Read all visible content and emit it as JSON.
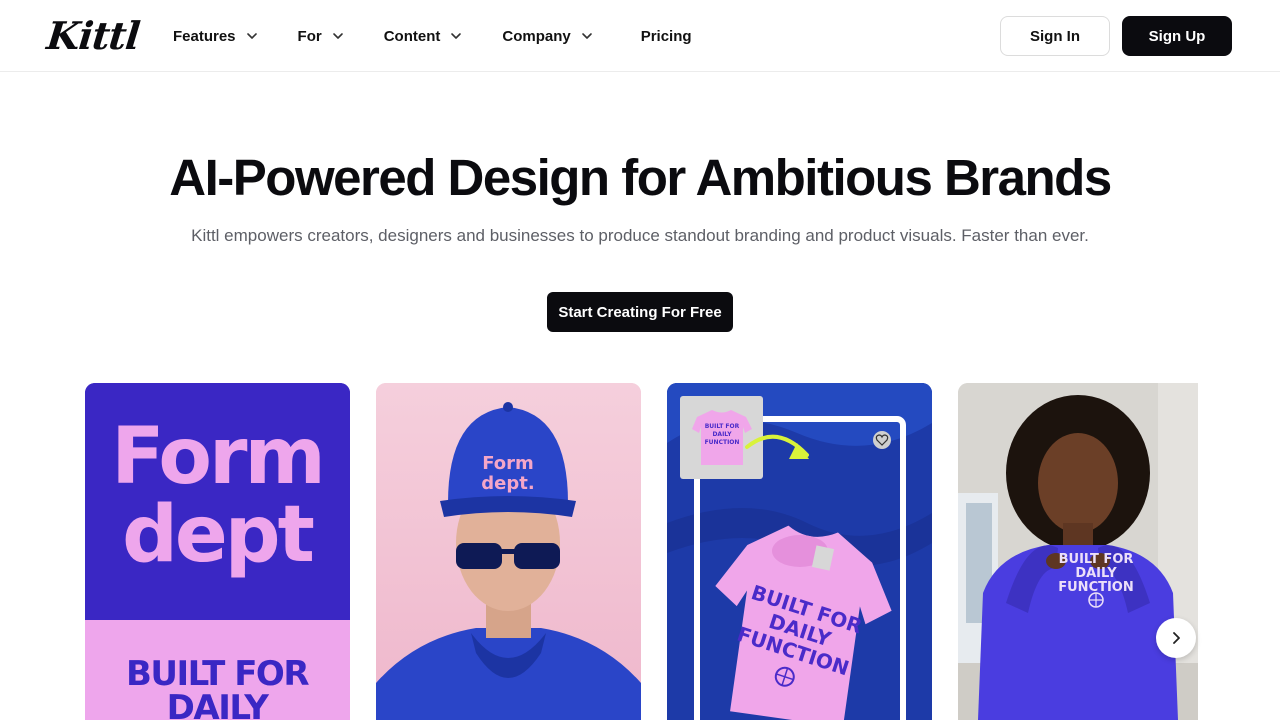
{
  "brand": {
    "logo_text": "Kittl"
  },
  "nav": {
    "items": [
      {
        "label": "Features",
        "has_dropdown": true
      },
      {
        "label": "For",
        "has_dropdown": true
      },
      {
        "label": "Content",
        "has_dropdown": true
      },
      {
        "label": "Company",
        "has_dropdown": true
      },
      {
        "label": "Pricing",
        "has_dropdown": false
      }
    ]
  },
  "auth": {
    "signin_label": "Sign In",
    "signup_label": "Sign Up"
  },
  "hero": {
    "title": "AI-Powered Design for Ambitious Brands",
    "subtitle": "Kittl empowers creators, designers and businesses to produce standout branding and product visuals. Faster than ever.",
    "cta_label": "Start Creating For Free"
  },
  "gallery": {
    "card1": {
      "logo_line1": "Form",
      "logo_line2": "dept",
      "tagline_line1": "BUILT FOR",
      "tagline_line2": "DAILY"
    },
    "card2": {
      "cap_line1": "Form",
      "cap_line2": "dept."
    },
    "card3": {
      "shirt_line1": "BUILT FOR",
      "shirt_line2": "DAILY",
      "shirt_line3": "FUNCTION"
    },
    "card4": {
      "shirt_line1": "BUILT FOR",
      "shirt_line2": "DAILY",
      "shirt_line3": "FUNCTION"
    }
  },
  "colors": {
    "primary_dark": "#0b0b0f",
    "brand_purple": "#3a27c4",
    "brand_pink": "#eea6ec",
    "royal_blue": "#1d3aa8"
  },
  "icons": {
    "nav_dropdown": "chevron-down-icon",
    "carousel_next": "chevron-right-icon",
    "favorite": "heart-icon",
    "globe": "globe-icon"
  }
}
